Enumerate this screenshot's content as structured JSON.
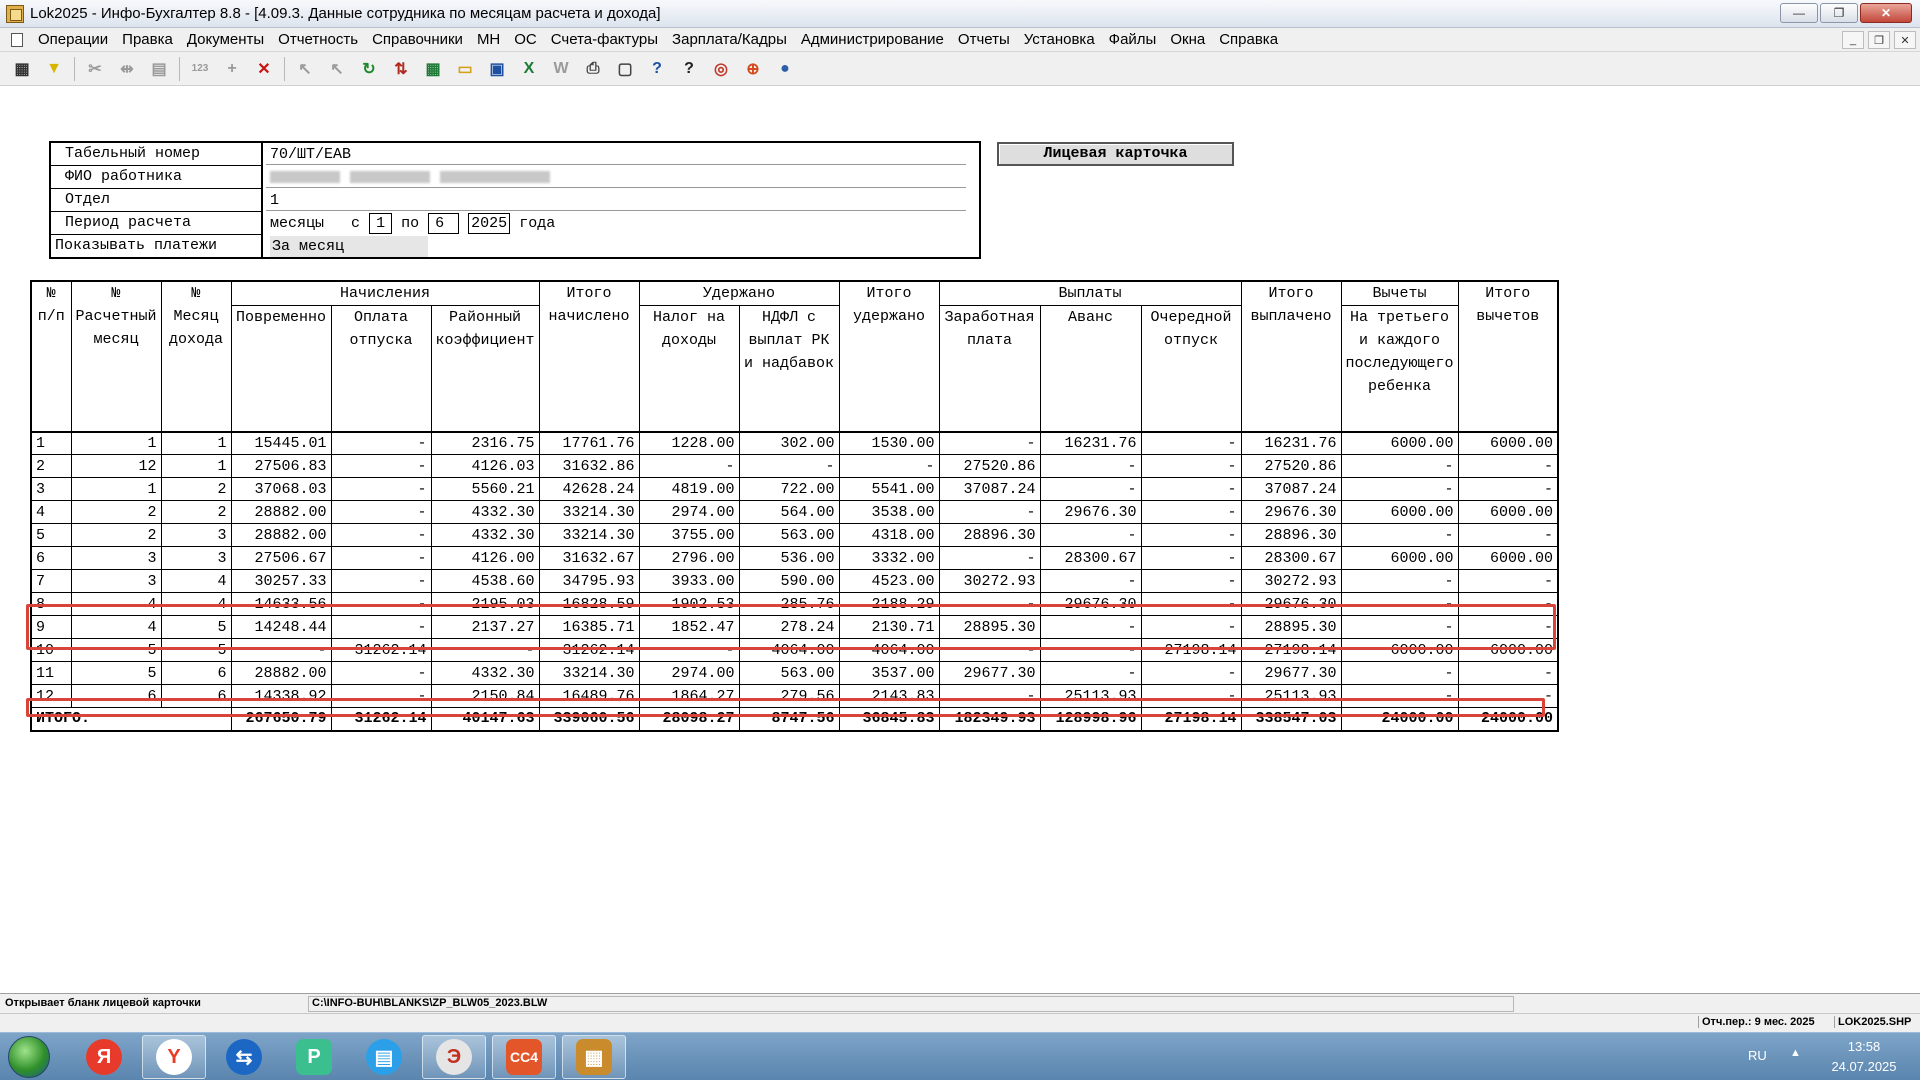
{
  "window": {
    "title": "Lok2025 - Инфо-Бухгалтер 8.8 - [4.09.3. Данные сотрудника по месяцам расчета и дохода]",
    "min": "—",
    "max": "❐",
    "close": "✕"
  },
  "menu": [
    "Операции",
    "Правка",
    "Документы",
    "Отчетность",
    "Справочники",
    "МН",
    "ОС",
    "Счета-фактуры",
    "Зарплата/Кадры",
    "Администрирование",
    "Отчеты",
    "Установка",
    "Файлы",
    "Окна",
    "Справка"
  ],
  "toolbar_icons": [
    "view-icon",
    "filter-icon",
    "cut-icon",
    "move-icon",
    "paste-icon",
    "number-icon",
    "add-icon",
    "delete-icon",
    "select-icon",
    "deselect-icon",
    "refresh-icon",
    "sort-icon",
    "calculator-icon",
    "open-icon",
    "save-icon",
    "excel-icon",
    "word-icon",
    "print-icon",
    "preview-icon",
    "help-icon",
    "context-help-icon",
    "compass-icon",
    "support-icon",
    "web-icon"
  ],
  "form": {
    "tab_label": "Табельный номер",
    "tab_value": "70/ШТ/ЕАВ",
    "fio_label": "ФИО работника",
    "dept_label": "Отдел",
    "dept_value": "1",
    "period_label": "Период расчета",
    "period_months": "месяцы",
    "period_from_label": "с",
    "period_from": "1",
    "period_to_label": "по",
    "period_to": "6",
    "period_year": "2025",
    "period_year_label": "года",
    "show_label": "Показывать платежи",
    "show_value": "За месяц"
  },
  "card_button": "Лицевая карточка",
  "table": {
    "group_headers": {
      "accruals": "Начисления",
      "withheld": "Удержано",
      "payments": "Выплаты",
      "deductions": "Вычеты"
    },
    "columns": [
      "№ п/п",
      "№ Расчетный месяц",
      "№ Месяц дохода",
      "Повременно",
      "Оплата отпуска",
      "Районный коэффициент",
      "Итого начислено",
      "Налог на доходы",
      "НДФЛ с выплат РК и надбавок",
      "Итого удержано",
      "Заработная плата",
      "Аванс",
      "Очередной отпуск",
      "Итого выплачено",
      "На третьего и каждого последующего ребенка",
      "Итого вычетов"
    ],
    "rows": [
      [
        "1",
        "1",
        "1",
        "15445.01",
        "-",
        "2316.75",
        "17761.76",
        "1228.00",
        "302.00",
        "1530.00",
        "-",
        "16231.76",
        "-",
        "16231.76",
        "6000.00",
        "6000.00"
      ],
      [
        "2",
        "12",
        "1",
        "27506.83",
        "-",
        "4126.03",
        "31632.86",
        "-",
        "-",
        "-",
        "27520.86",
        "-",
        "-",
        "27520.86",
        "-",
        "-"
      ],
      [
        "3",
        "1",
        "2",
        "37068.03",
        "-",
        "5560.21",
        "42628.24",
        "4819.00",
        "722.00",
        "5541.00",
        "37087.24",
        "-",
        "-",
        "37087.24",
        "-",
        "-"
      ],
      [
        "4",
        "2",
        "2",
        "28882.00",
        "-",
        "4332.30",
        "33214.30",
        "2974.00",
        "564.00",
        "3538.00",
        "-",
        "29676.30",
        "-",
        "29676.30",
        "6000.00",
        "6000.00"
      ],
      [
        "5",
        "2",
        "3",
        "28882.00",
        "-",
        "4332.30",
        "33214.30",
        "3755.00",
        "563.00",
        "4318.00",
        "28896.30",
        "-",
        "-",
        "28896.30",
        "-",
        "-"
      ],
      [
        "6",
        "3",
        "3",
        "27506.67",
        "-",
        "4126.00",
        "31632.67",
        "2796.00",
        "536.00",
        "3332.00",
        "-",
        "28300.67",
        "-",
        "28300.67",
        "6000.00",
        "6000.00"
      ],
      [
        "7",
        "3",
        "4",
        "30257.33",
        "-",
        "4538.60",
        "34795.93",
        "3933.00",
        "590.00",
        "4523.00",
        "30272.93",
        "-",
        "-",
        "30272.93",
        "-",
        "-"
      ],
      [
        "8",
        "4",
        "4",
        "14633.56",
        "-",
        "2195.03",
        "16828.59",
        "1902.53",
        "285.76",
        "2188.29",
        "-",
        "29676.30",
        "-",
        "29676.30",
        "-",
        "-"
      ],
      [
        "9",
        "4",
        "5",
        "14248.44",
        "-",
        "2137.27",
        "16385.71",
        "1852.47",
        "278.24",
        "2130.71",
        "28895.30",
        "-",
        "-",
        "28895.30",
        "-",
        "-"
      ],
      [
        "10",
        "5",
        "5",
        "-",
        "31262.14",
        "-",
        "31262.14",
        "-",
        "4064.00",
        "4064.00",
        "-",
        "-",
        "27198.14",
        "27198.14",
        "6000.00",
        "6000.00"
      ],
      [
        "11",
        "5",
        "6",
        "28882.00",
        "-",
        "4332.30",
        "33214.30",
        "2974.00",
        "563.00",
        "3537.00",
        "29677.30",
        "-",
        "-",
        "29677.30",
        "-",
        "-"
      ],
      [
        "12",
        "6",
        "6",
        "14338.92",
        "-",
        "2150.84",
        "16489.76",
        "1864.27",
        "279.56",
        "2143.83",
        "-",
        "25113.93",
        "-",
        "25113.93",
        "-",
        "-"
      ]
    ],
    "total_label": "ИТОГО:",
    "totals": [
      "267650.79",
      "31262.14",
      "40147.63",
      "339060.56",
      "28098.27",
      "8747.56",
      "36845.83",
      "182349.93",
      "128998.96",
      "27198.14",
      "338547.03",
      "24000.00",
      "24000.00"
    ]
  },
  "highlight_color": "#d9443a",
  "status": {
    "hint": "Открывает бланк лицевой карточки",
    "path": "C:\\INFO-BUH\\BLANKS\\ZP_BLW05_2023.BLW",
    "period": "Отч.пер.: 9 мес. 2025",
    "file": "LOK2025.SHP"
  },
  "taskbar": {
    "apps": [
      "Яндекс",
      "Яндекс Браузер",
      "TeamViewer",
      "Приложение",
      "Мессенджер",
      "Инфо-Бухгалтер",
      "СС4",
      "Счеты"
    ],
    "lang": "RU",
    "time": "13:58",
    "date": "24.07.2025"
  }
}
